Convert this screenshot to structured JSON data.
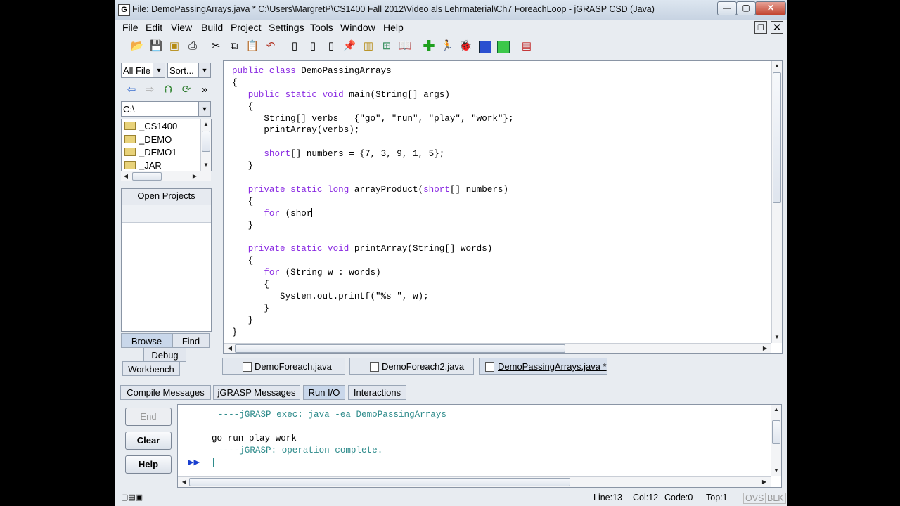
{
  "window": {
    "title": "File: DemoPassingArrays.java *  C:\\Users\\MargretP\\CS1400 Fall 2012\\Video als Lehrmaterial\\Ch7 ForeachLoop - jGRASP CSD (Java)",
    "app_icon": "G"
  },
  "menubar": [
    "File",
    "Edit",
    "View",
    "Build",
    "Project",
    "Settings",
    "Tools",
    "Window",
    "Help"
  ],
  "browser": {
    "filter_value": "All File",
    "sort_value": "Sort...",
    "path_value": "C:\\",
    "more_label": "»",
    "folders": [
      "_CS1400",
      "_DEMO",
      "_DEMO1",
      "_JAR"
    ],
    "open_projects_label": "Open Projects",
    "tabs": [
      "Browse",
      "Find",
      "Debug",
      "Workbench"
    ]
  },
  "editor": {
    "lines": [
      [
        [
          "kw",
          "public class "
        ],
        [
          "t",
          "DemoPassingArrays"
        ]
      ],
      [
        [
          "t",
          "{"
        ]
      ],
      [
        [
          "t",
          "   "
        ],
        [
          "kw",
          "public static void "
        ],
        [
          "t",
          "main(String[] args)"
        ]
      ],
      [
        [
          "t",
          "   {"
        ]
      ],
      [
        [
          "t",
          "      String[] verbs = {\"go\", \"run\", \"play\", \"work\"};"
        ]
      ],
      [
        [
          "t",
          "      printArray(verbs);"
        ]
      ],
      [
        [
          "t",
          ""
        ]
      ],
      [
        [
          "t",
          "      "
        ],
        [
          "kw",
          "short"
        ],
        [
          "t",
          "[] numbers = {7, 3, 9, 1, 5};"
        ]
      ],
      [
        [
          "t",
          "   }"
        ]
      ],
      [
        [
          "t",
          ""
        ]
      ],
      [
        [
          "t",
          "   "
        ],
        [
          "kw",
          "private static long "
        ],
        [
          "t",
          "arrayProduct("
        ],
        [
          "kw",
          "short"
        ],
        [
          "t",
          "[] numbers)"
        ]
      ],
      [
        [
          "t",
          "   {"
        ]
      ],
      [
        [
          "t",
          "      "
        ],
        [
          "kw",
          "for "
        ],
        [
          "t",
          "(shor"
        ]
      ],
      [
        [
          "t",
          "   }"
        ]
      ],
      [
        [
          "t",
          ""
        ]
      ],
      [
        [
          "t",
          "   "
        ],
        [
          "kw",
          "private static void "
        ],
        [
          "t",
          "printArray(String[] words)"
        ]
      ],
      [
        [
          "t",
          "   {"
        ]
      ],
      [
        [
          "t",
          "      "
        ],
        [
          "kw",
          "for "
        ],
        [
          "t",
          "(String w : words)"
        ]
      ],
      [
        [
          "t",
          "      {"
        ]
      ],
      [
        [
          "t",
          "         System.out.printf(\"%s \", w);"
        ]
      ],
      [
        [
          "t",
          "      }"
        ]
      ],
      [
        [
          "t",
          "   }"
        ]
      ],
      [
        [
          "t",
          "}"
        ]
      ]
    ],
    "file_tabs": [
      "DemoForeach.java",
      "DemoForeach2.java",
      "DemoPassingArrays.java *"
    ]
  },
  "messages": {
    "tabs": [
      "Compile Messages",
      "jGRASP Messages",
      "Run I/O",
      "Interactions"
    ],
    "buttons": [
      "End",
      "Clear",
      "Help"
    ],
    "output_exec": "----jGRASP exec: java -ea DemoPassingArrays",
    "output_program": "go run play work",
    "output_complete": "----jGRASP: operation complete.",
    "prompt": "▶▶"
  },
  "status": {
    "line": "Line:13",
    "col": "Col:12",
    "code": "Code:0",
    "top": "Top:1",
    "ovs": "OVS",
    "blk": "BLK"
  },
  "colors": {
    "keyword": "#8a2be2",
    "output_text": "#2e8b8b",
    "window_bg": "#e8ecf1"
  }
}
